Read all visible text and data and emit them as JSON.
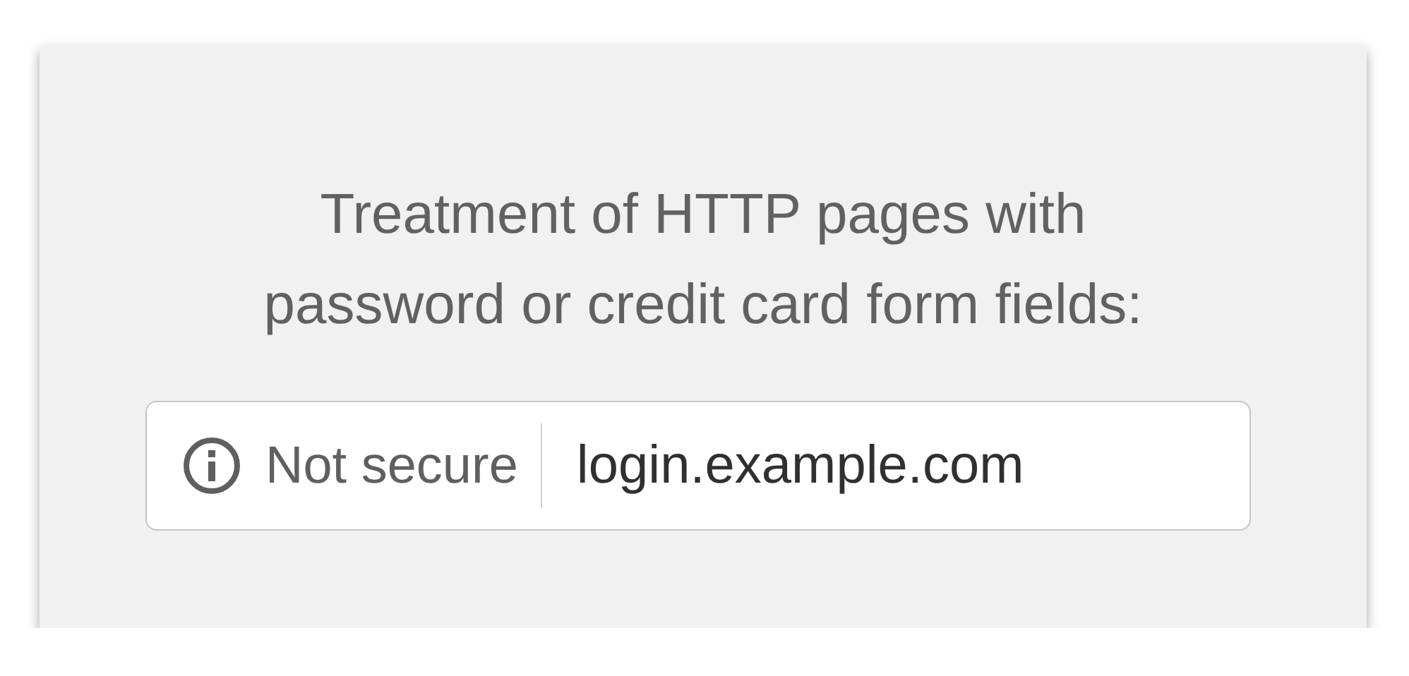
{
  "heading": "Treatment of HTTP pages with password or credit card form fields:",
  "address_bar": {
    "security_label": "Not secure",
    "url": "login.example.com"
  }
}
